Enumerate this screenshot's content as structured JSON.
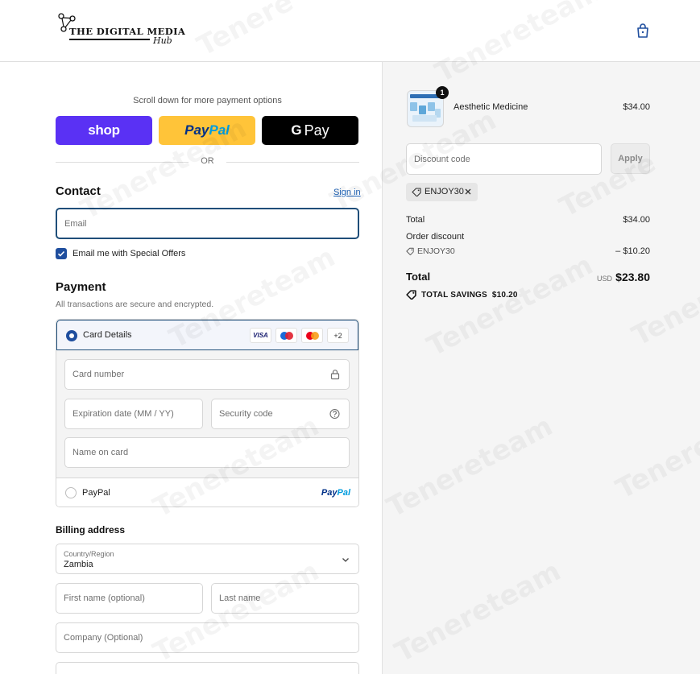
{
  "header": {
    "logo_title": "THE DIGITAL MEDIA",
    "logo_subtitle": "Hub",
    "cart_icon": "shopping-bag-icon"
  },
  "express": {
    "scroll_hint": "Scroll down for more payment options",
    "shop_label": "shop",
    "paypal_label_a": "Pay",
    "paypal_label_b": "Pal",
    "gpay_label_g": "G",
    "gpay_label": "Pay",
    "or_label": "OR"
  },
  "contact": {
    "title": "Contact",
    "sign_in": "Sign in",
    "email_placeholder": "Email",
    "offers_label": "Email me with Special Offers",
    "offers_checked": true
  },
  "payment": {
    "title": "Payment",
    "subtitle": "All transactions are secure and encrypted.",
    "card_label": "Card Details",
    "card_logos": {
      "visa": "VISA",
      "more": "+2"
    },
    "card_number_placeholder": "Card number",
    "expiry_placeholder": "Expiration date (MM / YY)",
    "security_placeholder": "Security code",
    "name_placeholder": "Name on card",
    "paypal_label": "PayPal",
    "paypal_logo_a": "Pay",
    "paypal_logo_b": "Pal"
  },
  "billing": {
    "title": "Billing address",
    "country_label": "Country/Region",
    "country_value": "Zambia",
    "first_name_placeholder": "First name (optional)",
    "last_name_placeholder": "Last name",
    "company_placeholder": "Company (Optional)"
  },
  "summary": {
    "product_name": "Aesthetic Medicine",
    "product_price": "$34.00",
    "quantity": "1",
    "discount_placeholder": "Discount code",
    "apply_label": "Apply",
    "applied_code": "ENJOY30",
    "total_label": "Total",
    "subtotal_value": "$34.00",
    "order_discount_label": "Order discount",
    "discount_code": "ENJOY30",
    "discount_value": "– $10.20",
    "grand_total_label": "Total",
    "currency": "USD",
    "grand_total_value": "$23.80",
    "savings_label": "TOTAL SAVINGS",
    "savings_value": "$10.20"
  },
  "colors": {
    "accent": "#1f4e9e",
    "shop_purple": "#5a31f4",
    "paypal_yellow": "#ffc439"
  }
}
